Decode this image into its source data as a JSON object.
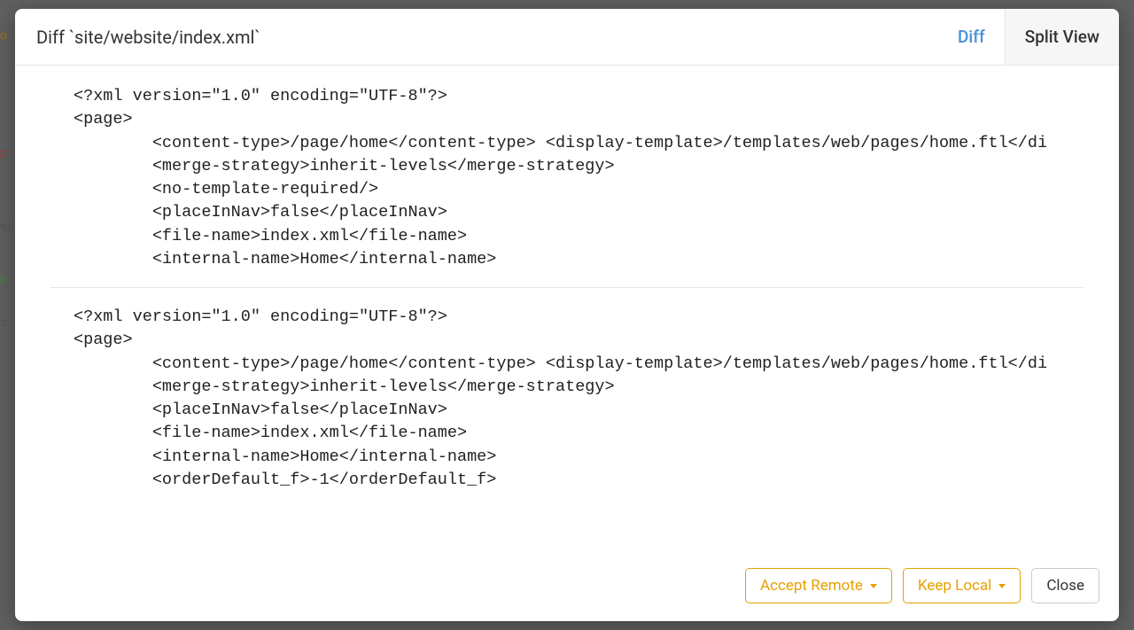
{
  "header": {
    "title": "Diff `site/website/index.xml`",
    "tabs": {
      "diff": "Diff",
      "split": "Split View"
    }
  },
  "code": {
    "top": "<?xml version=\"1.0\" encoding=\"UTF-8\"?>\n<page>\n        <content-type>/page/home</content-type> <display-template>/templates/web/pages/home.ftl</di\n        <merge-strategy>inherit-levels</merge-strategy>\n        <no-template-required/>\n        <placeInNav>false</placeInNav>\n        <file-name>index.xml</file-name>\n        <internal-name>Home</internal-name>",
    "bottom": "<?xml version=\"1.0\" encoding=\"UTF-8\"?>\n<page>\n        <content-type>/page/home</content-type> <display-template>/templates/web/pages/home.ftl</di\n        <merge-strategy>inherit-levels</merge-strategy>\n        <placeInNav>false</placeInNav>\n        <file-name>index.xml</file-name>\n        <internal-name>Home</internal-name>\n        <orderDefault_f>-1</orderDefault_f>"
  },
  "footer": {
    "accept": "Accept Remote",
    "keep": "Keep Local",
    "close": "Close"
  },
  "bg": {
    "t1": "o",
    "t2": "F",
    "t3": "e/",
    "t4": "o",
    "t5": "s"
  }
}
